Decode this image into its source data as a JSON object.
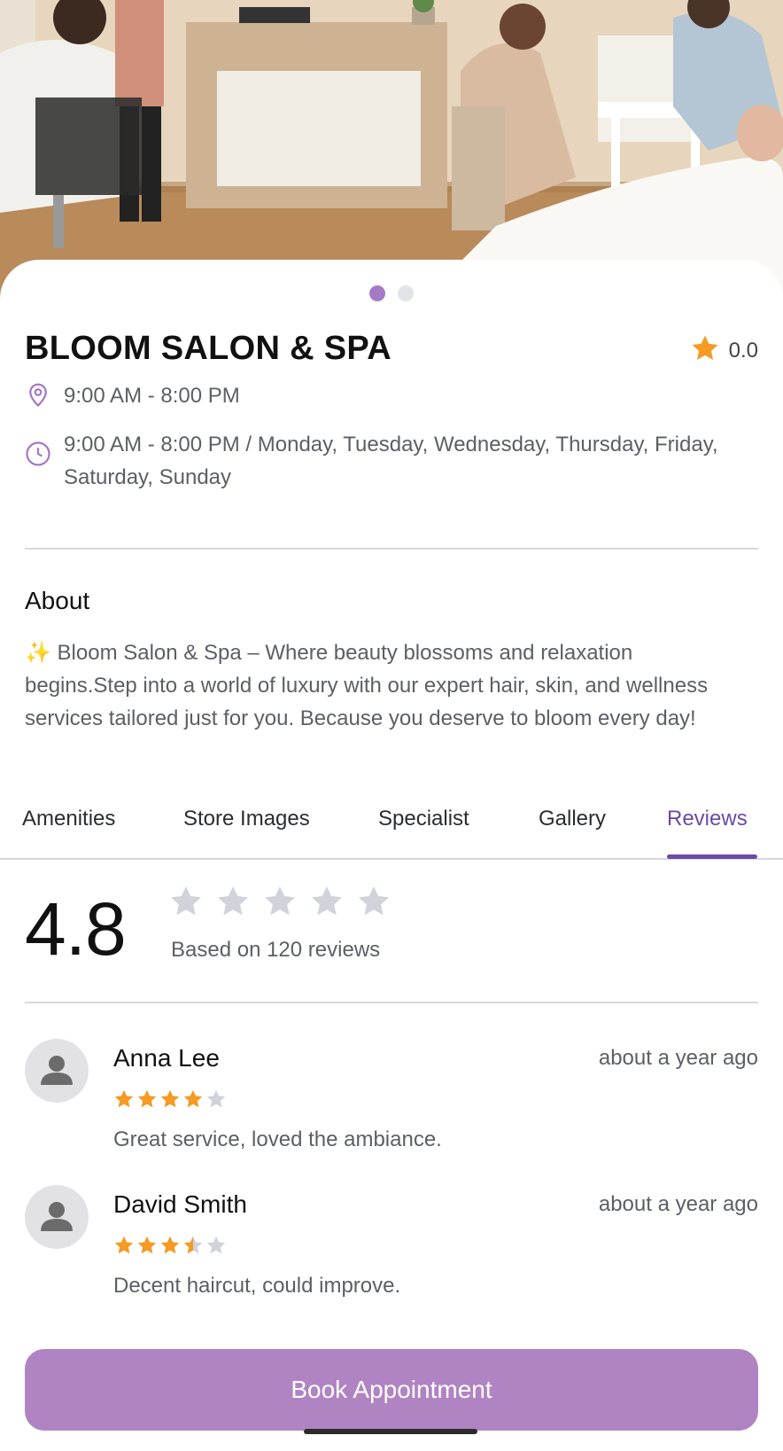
{
  "carousel": {
    "count": 2,
    "active": 0
  },
  "store": {
    "name": "BLOOM SALON & SPA",
    "rating": "0.0",
    "location_line": "9:00 AM - 8:00 PM",
    "hours_line": "9:00 AM - 8:00 PM / Monday, Tuesday, Wednesday, Thursday, Friday, Saturday, Sunday"
  },
  "about": {
    "heading": "About",
    "text": "✨ Bloom Salon & Spa – Where beauty blossoms and relaxation begins.Step into a world of luxury with our expert hair, skin, and wellness services tailored just for you. Because you deserve to bloom every day!"
  },
  "tabs": [
    {
      "label": "Amenities",
      "active": false
    },
    {
      "label": "Store Images",
      "active": false
    },
    {
      "label": "Specialist",
      "active": false
    },
    {
      "label": "Gallery",
      "active": false
    },
    {
      "label": "Reviews",
      "active": true
    }
  ],
  "reviews_summary": {
    "score": "4.8",
    "stars_filled": 0,
    "based_on": "Based on 120 reviews"
  },
  "reviews": [
    {
      "name": "Anna Lee",
      "time": "about a year ago",
      "rating": 4,
      "text": "Great service, loved the ambiance."
    },
    {
      "name": "David Smith",
      "time": "about a year ago",
      "rating": 3.5,
      "text": "Decent haircut, could improve."
    }
  ],
  "cta": {
    "label": "Book Appointment"
  },
  "colors": {
    "accent": "#6a4aa5",
    "button": "#b084c2",
    "star": "#f59a23",
    "star_empty": "#d0d3da",
    "icon": "#a57ac5"
  },
  "icons": {
    "location": "location-pin-icon",
    "clock": "clock-icon",
    "star": "star-icon",
    "avatar": "user-avatar-icon"
  }
}
